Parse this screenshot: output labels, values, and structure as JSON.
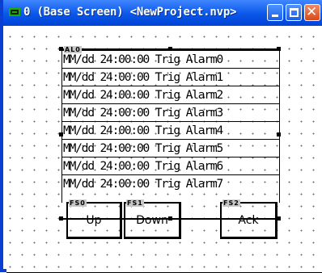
{
  "window": {
    "title": "0 (Base Screen) <NewProject.nvp>",
    "titlebar_color": "#0a56e8",
    "icons": [
      "screen-icon",
      "minimize-icon",
      "maximize-icon",
      "close-icon"
    ]
  },
  "alarm_list": {
    "tag": "AL0",
    "rows": [
      "MM/dd 24:00:00 Trig Alarm0",
      "MM/dd 24:00:00 Trig Alarm1",
      "MM/dd 24:00:00 Trig Alarm2",
      "MM/dd 24:00:00 Trig Alarm3",
      "MM/dd 24:00:00 Trig Alarm4",
      "MM/dd 24:00:00 Trig Alarm5",
      "MM/dd 24:00:00 Trig Alarm6",
      "MM/dd 24:00:00 Trig Alarm7"
    ]
  },
  "function_buttons": [
    {
      "tag": "FS0",
      "label": "Up"
    },
    {
      "tag": "FS1",
      "label": "Down"
    },
    {
      "tag": "FS2",
      "label": "Ack"
    }
  ],
  "colors": {
    "grid_dot": "#6a6a6a",
    "tag_background": "#c8c8c8",
    "close_button": "#d84a1b"
  }
}
